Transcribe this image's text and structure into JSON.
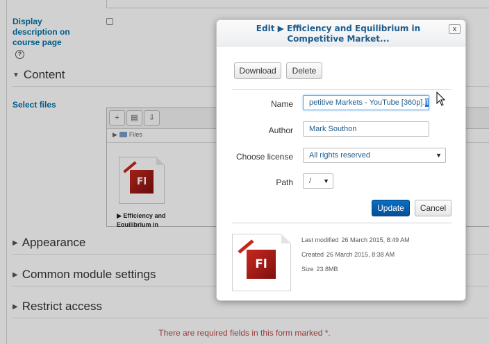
{
  "background": {
    "display_description_label": "Display description on course page",
    "sections": {
      "content": "Content",
      "appearance": "Appearance",
      "common_module_settings": "Common module settings",
      "restrict_access": "Restrict access"
    },
    "select_files_label": "Select files",
    "filepicker": {
      "path_label": "Files",
      "file_name": "▶ Efficiency and Equilibrium in"
    },
    "required_message": "There are required fields in this form marked *."
  },
  "dialog": {
    "title": "Edit ▶ Efficiency and Equilibrium in Competitive Market...",
    "close_label": "x",
    "download_label": "Download",
    "delete_label": "Delete",
    "name_label": "Name",
    "name_value": "petitive Markets - YouTube [360p].",
    "name_selected_ext": "flv",
    "author_label": "Author",
    "author_value": "Mark Southon",
    "license_label": "Choose license",
    "license_value": "All rights reserved",
    "path_label": "Path",
    "path_value": "/",
    "update_label": "Update",
    "cancel_label": "Cancel",
    "last_modified_label": "Last modified",
    "last_modified_value": "26 March 2015, 8:49 AM",
    "created_label": "Created",
    "created_value": "26 March 2015, 8:38 AM",
    "size_label": "Size",
    "size_value": "23.8MB"
  },
  "icons": {
    "file_type": "flash-file-icon",
    "file_type_text": "Fl"
  },
  "colors": {
    "link_blue": "#0070a8",
    "primary_button": "#054f99",
    "required_text": "#b94a48"
  }
}
